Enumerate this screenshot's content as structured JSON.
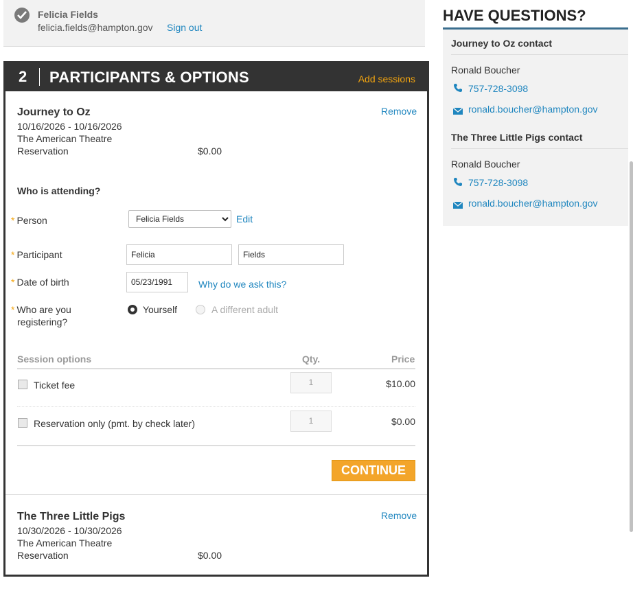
{
  "signin": {
    "name": "Felicia Fields",
    "email": "felicia.fields@hampton.gov",
    "signout_label": "Sign out"
  },
  "panel": {
    "step_number": "2",
    "title": "PARTICIPANTS & OPTIONS",
    "add_sessions_label": "Add sessions"
  },
  "event1": {
    "title": "Journey to Oz",
    "dates": "10/16/2026 - 10/16/2026",
    "venue": "The American Theatre",
    "type": "Reservation",
    "price": "$0.00",
    "remove_label": "Remove"
  },
  "attending": {
    "heading": "Who is attending?",
    "req_mark": "*",
    "person_label": "Person",
    "person_selected": "Felicia Fields",
    "edit_label": "Edit",
    "participant_label": "Participant",
    "first_name": "Felicia",
    "last_name": "Fields",
    "dob_label": "Date of birth",
    "dob_value": "05/23/1991",
    "why_label": "Why do we ask this?",
    "who_label_line1": "Who are you",
    "who_label_line2": "registering?",
    "option_yourself": "Yourself",
    "option_other": "A different adult"
  },
  "session_options": {
    "header_name": "Session options",
    "header_qty": "Qty.",
    "header_price": "Price",
    "rows": [
      {
        "label": "Ticket fee",
        "qty": "1",
        "price": "$10.00"
      },
      {
        "label": "Reservation only (pmt. by check later)",
        "qty": "1",
        "price": "$0.00"
      }
    ]
  },
  "continue_label": "CONTINUE",
  "event2": {
    "title": "The Three Little Pigs",
    "dates": "10/30/2026 - 10/30/2026",
    "venue": "The American Theatre",
    "type": "Reservation",
    "price": "$0.00",
    "remove_label": "Remove"
  },
  "sidebar": {
    "title": "HAVE QUESTIONS?",
    "contacts": [
      {
        "heading": "Journey to Oz contact",
        "name": "Ronald Boucher",
        "phone": "757-728-3098",
        "email": "ronald.boucher@hampton.gov"
      },
      {
        "heading": "The Three Little Pigs contact",
        "name": "Ronald Boucher",
        "phone": "757-728-3098",
        "email": "ronald.boucher@hampton.gov"
      }
    ]
  },
  "colors": {
    "accent_orange": "#f3a50f",
    "link_blue": "#1f86bf",
    "header_dark": "#333333",
    "sidebar_bar": "#3a6e8e"
  },
  "icons": [
    "check-circle-icon",
    "phone-icon",
    "mail-icon",
    "chevron-down-icon"
  ]
}
